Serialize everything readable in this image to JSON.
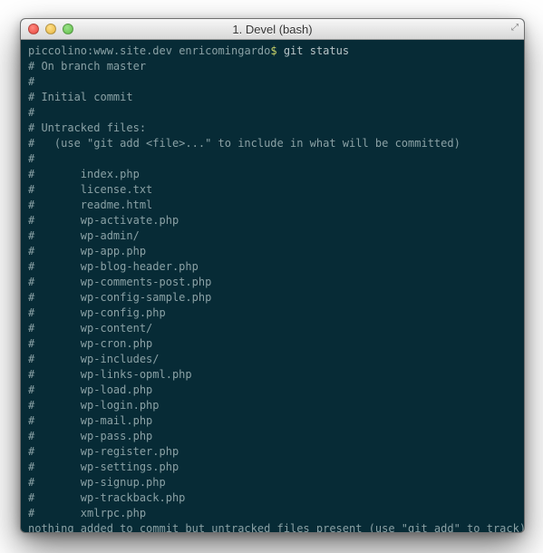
{
  "window": {
    "title": "1. Devel (bash)"
  },
  "colors": {
    "bg": "#072b36",
    "text": "#8aa1a5",
    "accent": "#c9d36a"
  },
  "prompt": {
    "host": "piccolino",
    "cwd": "www.site.dev",
    "user": "enricomingardo",
    "sep1": ":",
    "sep2": " ",
    "dollar": "$"
  },
  "command": "git status",
  "output_lines": [
    "# On branch master",
    "#",
    "# Initial commit",
    "#",
    "# Untracked files:",
    "#   (use \"git add <file>...\" to include in what will be committed)",
    "#",
    "#       index.php",
    "#       license.txt",
    "#       readme.html",
    "#       wp-activate.php",
    "#       wp-admin/",
    "#       wp-app.php",
    "#       wp-blog-header.php",
    "#       wp-comments-post.php",
    "#       wp-config-sample.php",
    "#       wp-config.php",
    "#       wp-content/",
    "#       wp-cron.php",
    "#       wp-includes/",
    "#       wp-links-opml.php",
    "#       wp-load.php",
    "#       wp-login.php",
    "#       wp-mail.php",
    "#       wp-pass.php",
    "#       wp-register.php",
    "#       wp-settings.php",
    "#       wp-signup.php",
    "#       wp-trackback.php",
    "#       xmlrpc.php",
    "nothing added to commit but untracked files present (use \"git add\" to track)"
  ]
}
